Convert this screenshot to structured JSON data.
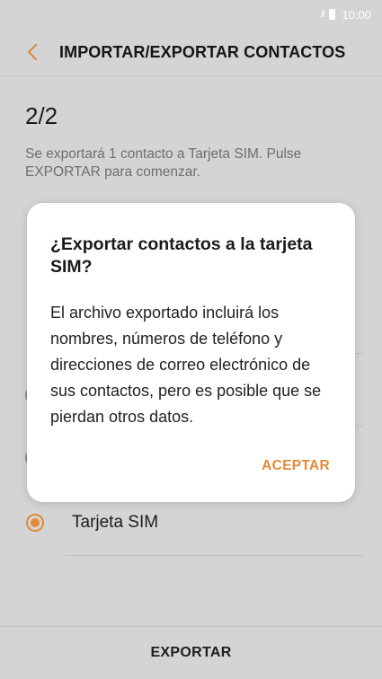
{
  "status_bar": {
    "signal_icon": "signal-icon",
    "battery_icon": "battery-icon",
    "time": "10:00"
  },
  "header": {
    "title": "IMPORTAR/EXPORTAR CONTACTOS",
    "back_icon": "chevron-left-icon"
  },
  "step": "2/2",
  "description": "Se exportará 1 contacto a Tarjeta SIM. Pulse EXPORTAR para comenzar.",
  "options": [
    {
      "label": "Tarjeta SIM",
      "selected": true
    }
  ],
  "dialog": {
    "title": "¿Exportar contactos a la tarjeta SIM?",
    "body": "El archivo exportado incluirá los nombres, números de teléfono y direcciones de correo electrónico de sus contactos, pero es posible que se pierdan otros datos.",
    "accept_label": "ACEPTAR"
  },
  "footer": {
    "export_label": "EXPORTAR"
  },
  "colors": {
    "accent": "#e28a3a",
    "overlay_background": "#d4d4d4",
    "dialog_background": "#ffffff"
  }
}
